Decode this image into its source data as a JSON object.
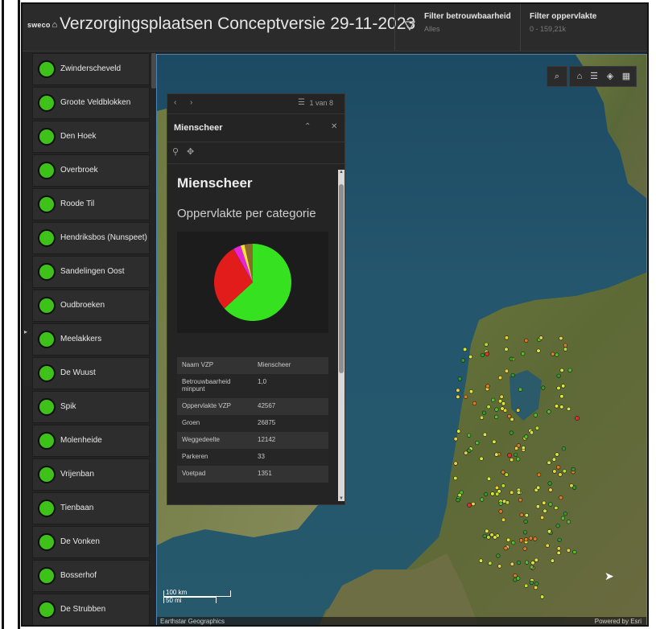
{
  "header": {
    "logo": "sweco",
    "title": "Verzorgingsplaatsen Conceptversie 29-11-2023",
    "filter1": {
      "title": "Filter betrouwbaarheid",
      "value": "Alles"
    },
    "filter2": {
      "title": "Filter oppervlakte",
      "value": "0 - 159,21k"
    }
  },
  "sidebar": {
    "items": [
      {
        "label": "Zwinderscheveld"
      },
      {
        "label": "Groote Veldblokken"
      },
      {
        "label": "Den Hoek"
      },
      {
        "label": "Overbroek"
      },
      {
        "label": "Roode Til"
      },
      {
        "label": "Hendriksbos (Nunspeet)"
      },
      {
        "label": "Sandelingen Oost"
      },
      {
        "label": "Oudbroeken"
      },
      {
        "label": "Meelakkers"
      },
      {
        "label": "De Wuust"
      },
      {
        "label": "Spik"
      },
      {
        "label": "Molenheide"
      },
      {
        "label": "Vrijenban"
      },
      {
        "label": "Tienbaan"
      },
      {
        "label": "De Vonken"
      },
      {
        "label": "Bosserhof"
      },
      {
        "label": "De Strubben"
      }
    ],
    "status_color": "#3ec21a"
  },
  "map": {
    "toolbar_icons": [
      "search-icon",
      "home-icon",
      "list-icon",
      "layers-icon",
      "basemap-icon"
    ],
    "scale": {
      "km": "100 km",
      "mi": "50 mi"
    },
    "attribution_left": "Earthstar Geographics",
    "attribution_right": "Powered by Esri"
  },
  "popup": {
    "counter": "1 van 8",
    "header_name": "Mienscheer",
    "feature_title": "Mienscheer",
    "chart_title": "Oppervlakte per categorie",
    "fields": [
      {
        "key": "Naam VZP",
        "value": "Mienscheer"
      },
      {
        "key": "Betrouwbaarheid minpunt",
        "value": "1,0"
      },
      {
        "key": "Oppervlakte VZP",
        "value": "42567"
      },
      {
        "key": "Groen",
        "value": "26875"
      },
      {
        "key": "Weggedeelte",
        "value": "12142"
      },
      {
        "key": "Parkeren",
        "value": "33"
      },
      {
        "key": "Voetpad",
        "value": "1351"
      }
    ]
  },
  "chart_data": {
    "type": "pie",
    "values": [
      26875,
      12142,
      33,
      1351,
      700,
      1466
    ],
    "colors": [
      "#36e21f",
      "#e21b1b",
      "#3a3ad8",
      "#e825d6",
      "#f2e23a",
      "#8a6a2a"
    ]
  }
}
